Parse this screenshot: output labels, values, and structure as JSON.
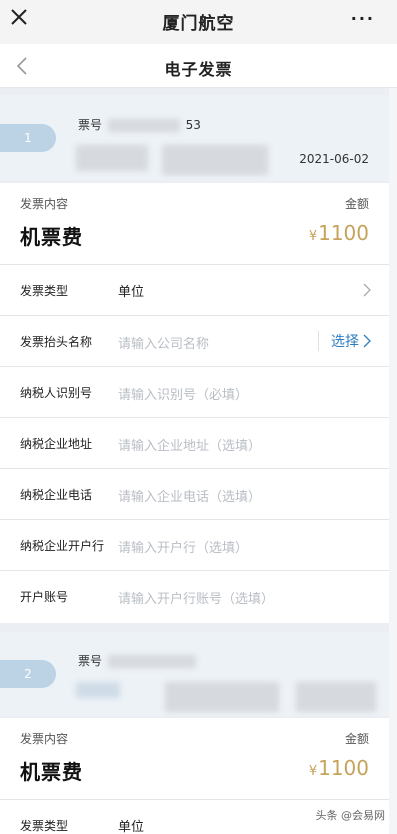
{
  "topbar": {
    "title": "厦门航空",
    "more_label": "···"
  },
  "navbar": {
    "title": "电子发票"
  },
  "tickets": [
    {
      "index": "1",
      "ticket_label": "票号",
      "ticket_suffix": "53",
      "date": "2021-06-02"
    },
    {
      "index": "2",
      "ticket_label": "票号",
      "ticket_suffix": "",
      "date": ""
    }
  ],
  "invoice1": {
    "content_label": "发票内容",
    "amount_label": "金额",
    "content_value": "机票费",
    "currency": "¥",
    "amount_value": "1100",
    "fields": [
      {
        "label": "发票类型",
        "value": "单位",
        "placeholder": ""
      },
      {
        "label": "发票抬头名称",
        "value": "",
        "placeholder": "请输入公司名称",
        "action": "选择"
      },
      {
        "label": "纳税人识别号",
        "value": "",
        "placeholder": "请输入识别号（必填）"
      },
      {
        "label": "纳税企业地址",
        "value": "",
        "placeholder": "请输入企业地址（选填）"
      },
      {
        "label": "纳税企业电话",
        "value": "",
        "placeholder": "请输入企业电话（选填）"
      },
      {
        "label": "纳税企业开户行",
        "value": "",
        "placeholder": "请输入开户行（选填）"
      },
      {
        "label": "开户账号",
        "value": "",
        "placeholder": "请输入开户行账号（选填）"
      }
    ]
  },
  "invoice2": {
    "content_label": "发票内容",
    "amount_label": "金额",
    "content_value": "机票费",
    "currency": "¥",
    "amount_value": "1100",
    "fields": [
      {
        "label": "发票类型",
        "value": "单位"
      }
    ]
  },
  "watermark": "头条 @会易网",
  "colors": {
    "accent": "#2f7ec2",
    "amount": "#c6a35a",
    "badge": "#bcd3e5"
  }
}
